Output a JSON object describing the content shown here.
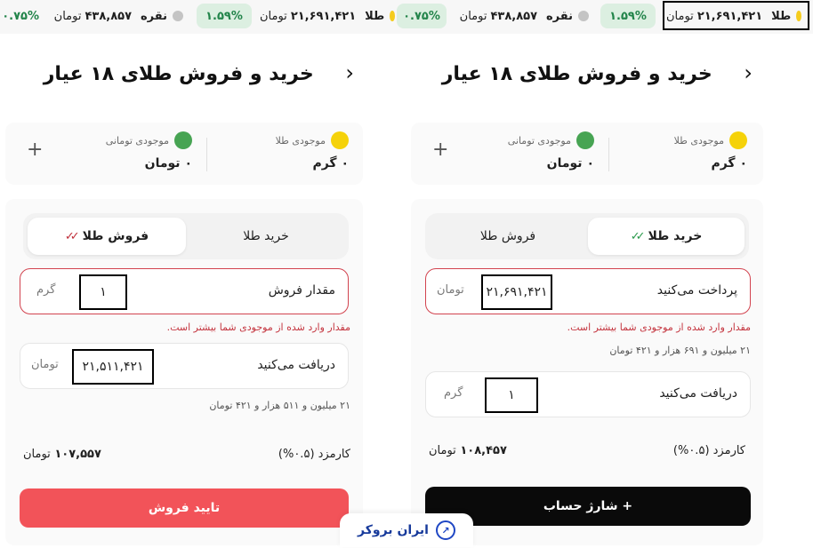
{
  "ticker": {
    "gold_name": "طلا",
    "silver_name": "نقره",
    "gold_price": "۲۱,۶۹۱,۴۲۱",
    "silver_price": "۴۳۸,۸۵۷",
    "unit": "تومان",
    "gold_change": "۱.۵۹%",
    "silver_change": "۰.۷۵%",
    "colors": {
      "positive_bg": "#dcefe1",
      "positive_text": "#22844a",
      "gold_dot": "#f5cc1e",
      "silver_dot": "#c4c4c4"
    }
  },
  "panels": {
    "buy": {
      "title": "خرید و فروش طلای ۱۸ عیار",
      "balances": {
        "gold_label": "موجودی طلا",
        "gold_value": "۰ گرم",
        "toman_label": "موجودی تومانی",
        "toman_value": "۰ تومان"
      },
      "tabs": {
        "buy": "خرید طلا",
        "sell": "فروش طلا",
        "active": "buy"
      },
      "pay_field": {
        "label": "پرداخت می‌کنید",
        "value": "۲۱,۶۹۱,۴۲۱",
        "unit": "تومان"
      },
      "error": "مقدار وارد شده از موجودی شما بیشتر است.",
      "words": "۲۱ میلیون و ۶۹۱ هزار و ۴۲۱ تومان",
      "receive_field": {
        "label": "دریافت می‌کنید",
        "value": "۱",
        "unit": "گرم"
      },
      "fee": {
        "label": "کارمزد (۰.۵%)",
        "value": "۱۰۸,۴۵۷",
        "unit": "تومان"
      },
      "cta": "+ شارژ حساب"
    },
    "sell": {
      "title": "خرید و فروش طلای ۱۸ عیار",
      "balances": {
        "gold_label": "موجودی طلا",
        "gold_value": "۰ گرم",
        "toman_label": "موجودی تومانی",
        "toman_value": "۰ تومان"
      },
      "tabs": {
        "buy": "خرید طلا",
        "sell": "فروش طلا",
        "active": "sell"
      },
      "amount_field": {
        "label": "مقدار فروش",
        "value": "۱",
        "unit": "گرم"
      },
      "error": "مقدار وارد شده از موجودی شما بیشتر است.",
      "receive_field": {
        "label": "دریافت می‌کنید",
        "value": "۲۱,۵۱۱,۴۲۱",
        "unit": "تومان"
      },
      "words": "۲۱ میلیون و ۵۱۱ هزار و ۴۲۱ تومان",
      "fee": {
        "label": "کارمزد (۰.۵%)",
        "value": "۱۰۷,۵۵۷",
        "unit": "تومان"
      },
      "cta": "تایید فروش"
    }
  },
  "branding": {
    "logo_text": "ایران بروکر"
  },
  "icons": {
    "back": "chevron-right-icon",
    "plus": "plus-icon",
    "check": "double-check-icon",
    "logo": "iranbroker-logo-icon"
  },
  "colors": {
    "error": "#d2434f",
    "sell_button": "#f25359",
    "charge_button": "#0a0a0a",
    "gold_coin": "#f5d20a",
    "toman_coin": "#47a453"
  }
}
